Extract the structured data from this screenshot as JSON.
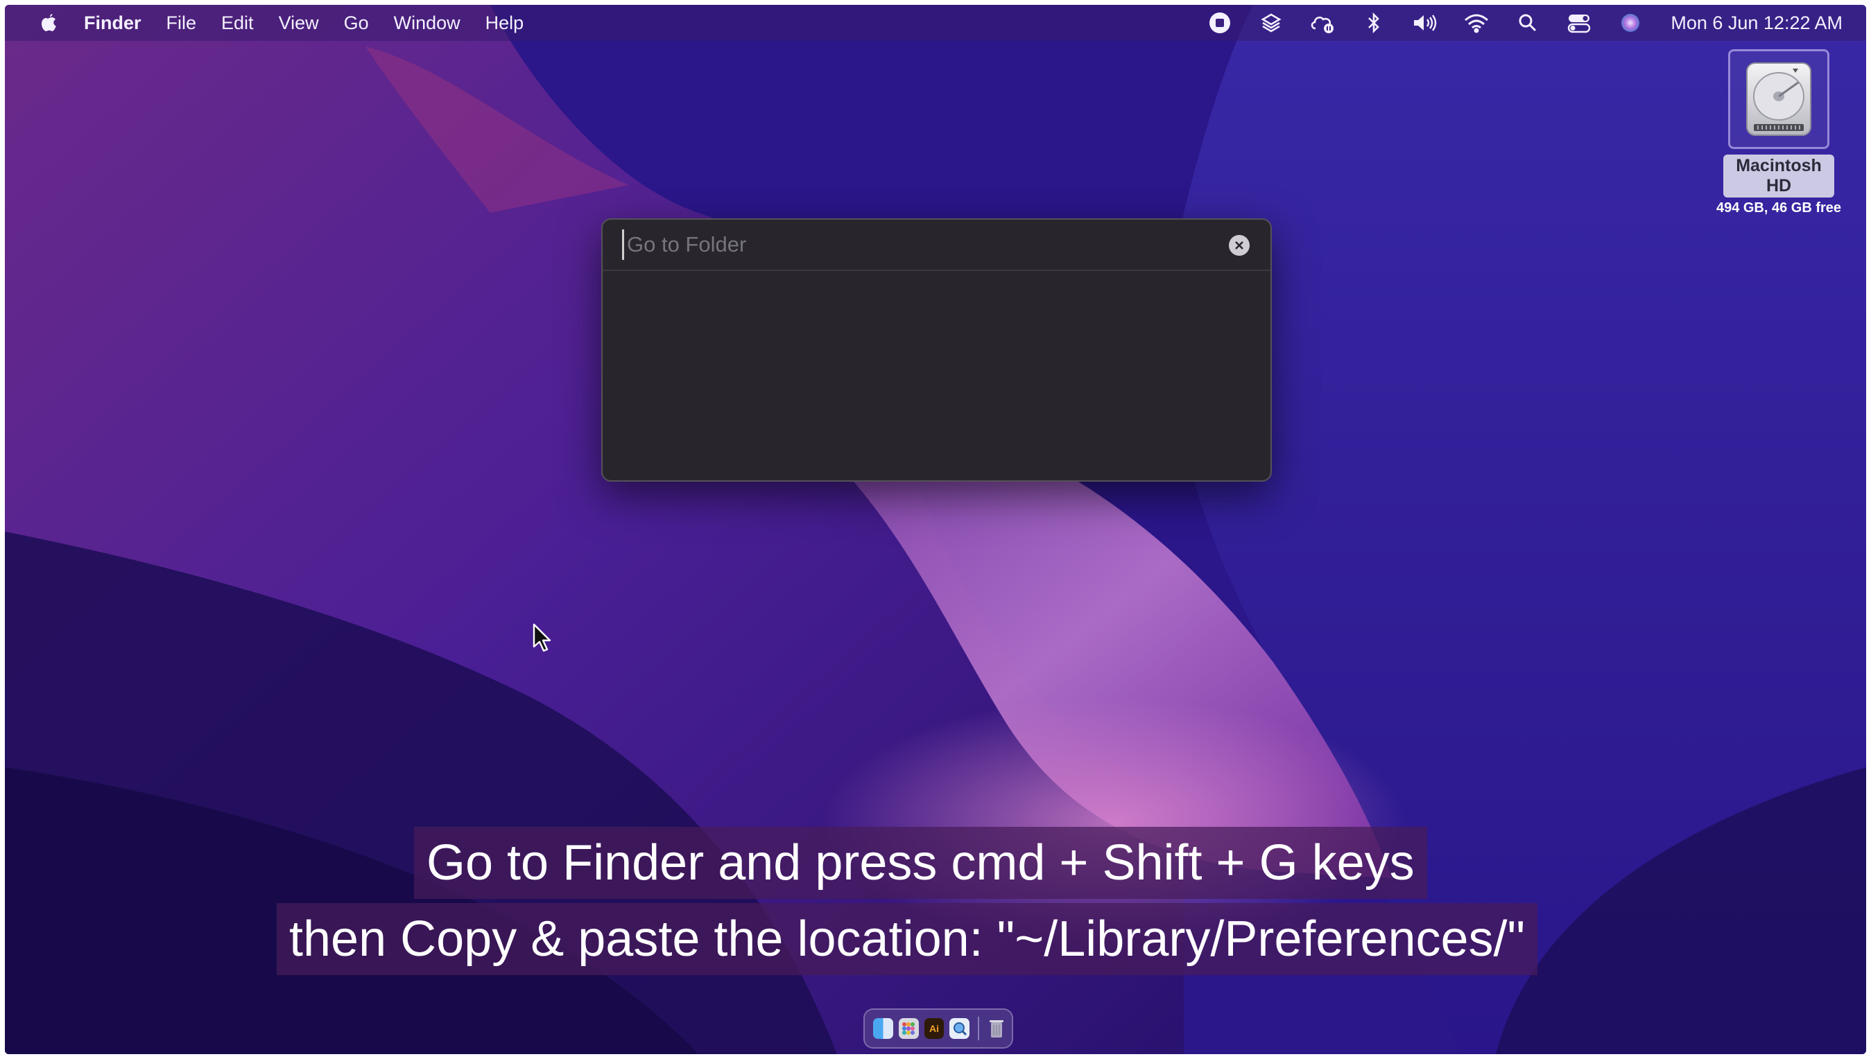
{
  "menubar": {
    "apple_icon": "apple-logo-icon",
    "items": [
      {
        "label": "Finder",
        "bold": true
      },
      {
        "label": "File"
      },
      {
        "label": "Edit"
      },
      {
        "label": "View"
      },
      {
        "label": "Go"
      },
      {
        "label": "Window"
      },
      {
        "label": "Help"
      }
    ],
    "status_icons": [
      "stop-record-icon",
      "layers-icon",
      "cloud-sync-icon",
      "bluetooth-icon",
      "volume-icon",
      "wifi-icon",
      "spotlight-search-icon",
      "control-center-icon",
      "siri-icon"
    ],
    "clock": "Mon 6 Jun  12:22 AM"
  },
  "desktop": {
    "disk": {
      "name": "Macintosh HD",
      "info": "494 GB, 46 GB free",
      "icon": "hard-drive-icon"
    }
  },
  "dialog": {
    "input_value": "",
    "placeholder": "Go to Folder",
    "clear_icon": "clear-icon"
  },
  "captions": {
    "line1": "Go to Finder and press cmd + Shift + G keys",
    "line2": "then Copy & paste the location: \"~/Library/Preferences/\""
  },
  "dock": {
    "apps": [
      {
        "name": "finder-icon",
        "glyph": ""
      },
      {
        "name": "launchpad-icon",
        "glyph": ""
      },
      {
        "name": "illustrator-icon",
        "glyph": "Ai"
      },
      {
        "name": "preview-icon",
        "glyph": ""
      }
    ],
    "trash": "trash-icon"
  },
  "colors": {
    "wallpaper_base": "#2c1676",
    "dialog_bg": "#28252d",
    "caption_bg": "#461c5a"
  }
}
